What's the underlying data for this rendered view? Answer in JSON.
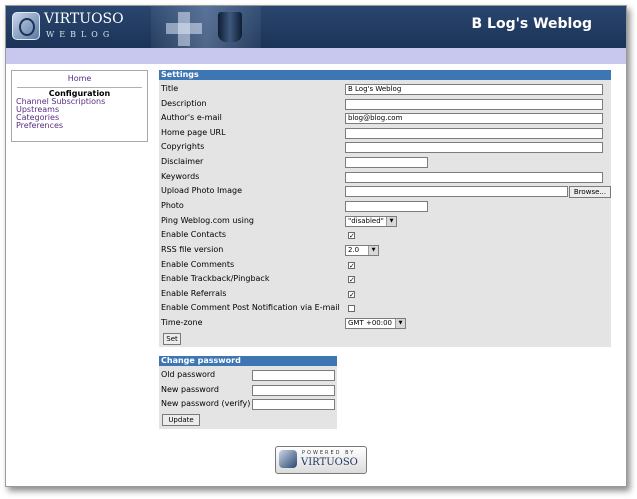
{
  "header": {
    "logo_text": "VIRTUOSO",
    "logo_sub": "WEBLOG",
    "blog_title": "B Log's Weblog"
  },
  "sidebar": {
    "home": "Home",
    "section_title": "Configuration",
    "items": [
      {
        "label": "Channel Subscriptions"
      },
      {
        "label": "Upstreams"
      },
      {
        "label": "Categories"
      },
      {
        "label": "Preferences"
      }
    ]
  },
  "settings": {
    "heading": "Settings",
    "title_label": "Title",
    "title_value": "B Log's Weblog",
    "description_label": "Description",
    "description_value": "",
    "email_label": "Author's e-mail",
    "email_value": "blog@blog.com",
    "homepage_label": "Home page URL",
    "homepage_value": "",
    "copyrights_label": "Copyrights",
    "copyrights_value": "",
    "disclaimer_label": "Disclaimer",
    "disclaimer_value": "",
    "keywords_label": "Keywords",
    "keywords_value": "",
    "upload_label": "Upload Photo Image",
    "upload_value": "",
    "browse_label": "Browse...",
    "photo_label": "Photo",
    "photo_value": "",
    "ping_label": "Ping Weblog.com using",
    "ping_value": "\"disabled\"",
    "contacts_label": "Enable Contacts",
    "contacts_checked": true,
    "rss_label": "RSS file version",
    "rss_value": "2.0",
    "comments_label": "Enable Comments",
    "comments_checked": true,
    "trackback_label": "Enable Trackback/Pingback",
    "trackback_checked": true,
    "referrals_label": "Enable Referrals",
    "referrals_checked": true,
    "notify_label": "Enable Comment Post Notification via E-mail",
    "notify_checked": false,
    "timezone_label": "Time-zone",
    "timezone_value": "GMT +00:00",
    "set_label": "Set"
  },
  "password": {
    "heading": "Change password",
    "old_label": "Old password",
    "new_label": "New password",
    "verify_label": "New password (verify)",
    "update_label": "Update"
  },
  "powered": {
    "by_text": "POWERED BY",
    "brand": "VIRTUOSO"
  }
}
